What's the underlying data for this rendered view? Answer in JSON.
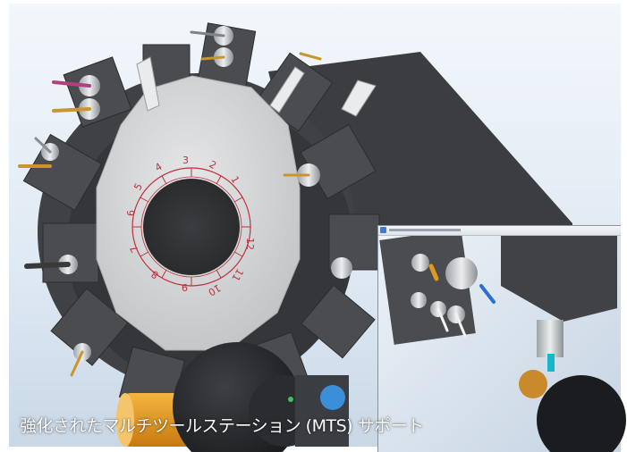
{
  "caption": "強化されたマルチツールステーション (MTS) サポート",
  "turret_station_numbers": [
    "1",
    "2",
    "3",
    "4",
    "5",
    "6",
    "7",
    "8",
    "9",
    "10",
    "11",
    "12"
  ],
  "colors": {
    "background": "#ffffff",
    "scene_sky": "#e8f0f8",
    "turret_body": "#3f4144",
    "turret_face": "#d8d9da",
    "index_marks": "#c0303a",
    "tool_highlight": "#e29a1c",
    "tool_cyan": "#17b6c9"
  },
  "icons": [
    "app-icon"
  ]
}
